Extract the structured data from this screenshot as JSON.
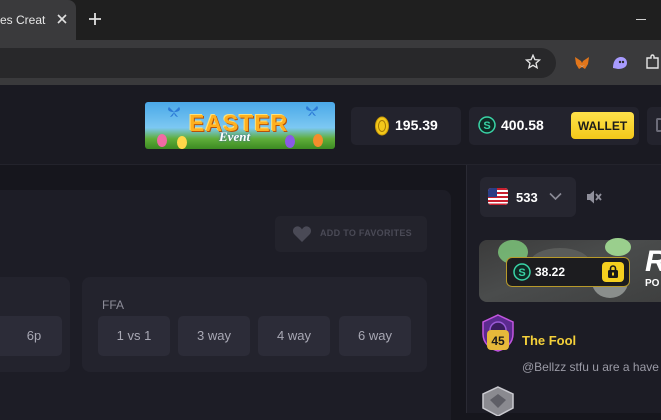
{
  "browser": {
    "tab_title": "es Creat",
    "colors": {
      "chrome_bg": "#1f1f1f",
      "toolbar_bg": "#3a3a3c"
    }
  },
  "header": {
    "easter_banner": {
      "title": "EASTER",
      "subtitle": "Event"
    },
    "balance": {
      "icon": "gold-egg-coin-icon",
      "value": "195.39"
    },
    "wallet": {
      "icon": "s-coin-icon",
      "value": "400.58",
      "button_label": "WALLET",
      "button_color": "#f3c81a"
    }
  },
  "main": {
    "favorites_label": "ADD TO FAVORITES",
    "left_card": {
      "button_label": "6p"
    },
    "ffa": {
      "title": "FFA",
      "options": [
        "1 vs 1",
        "3 way",
        "4 way",
        "6 way"
      ]
    }
  },
  "sidebar": {
    "country": {
      "flag": "us-flag-icon",
      "online_count": "533"
    },
    "mute_icon": "speaker-muted-icon",
    "rain": {
      "amount": "38.22",
      "title": "R",
      "subtitle": "PO"
    },
    "chat": [
      {
        "level": "45",
        "username": "The Fool",
        "message": "@Bellzz stfu u are a have"
      }
    ],
    "colors": {
      "username": "#f5d13a",
      "level_badge": "#e6b93a"
    }
  }
}
